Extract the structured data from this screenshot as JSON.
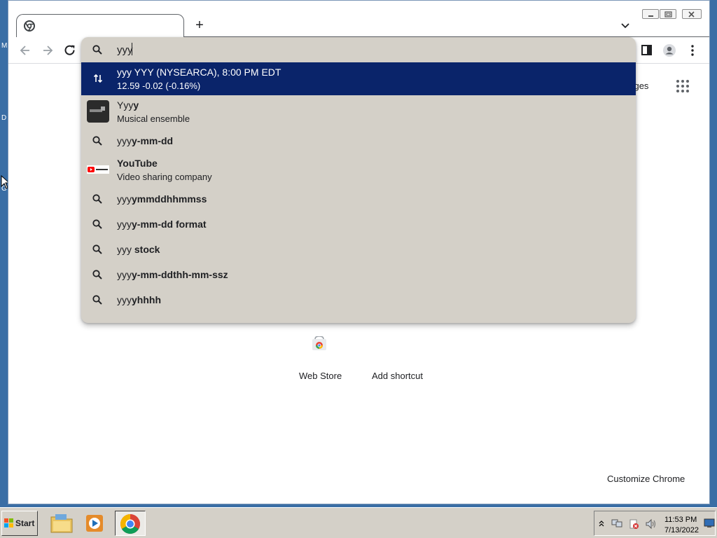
{
  "desktop": {
    "fragments": [
      "M",
      "D",
      "G"
    ]
  },
  "browser": {
    "tab": {
      "icon": "chrome-icon",
      "title": ""
    },
    "new_tab_label": "+",
    "omnibox": {
      "value": "yyy",
      "suggestions": [
        {
          "icon": "stock-arrows-icon",
          "line1_plain": "yyy YYY (NYSEARCA), 8:00 PM EDT",
          "line1_bold": "",
          "line2": "12.59 -0.02 (-0.16%)",
          "selected": true
        },
        {
          "icon": "album-thumbnail",
          "line1_plain": "Yyy",
          "line1_bold": "y",
          "line2": "Musical ensemble"
        },
        {
          "icon": "search-icon",
          "line1_plain": "yyy",
          "line1_bold": "y-mm-dd"
        },
        {
          "icon": "youtube-icon",
          "line1_plain": "",
          "line1_bold": "YouTube",
          "line2": "Video sharing company"
        },
        {
          "icon": "search-icon",
          "line1_plain": "yyy",
          "line1_bold": "ymmddhhmmss"
        },
        {
          "icon": "search-icon",
          "line1_plain": "yyy",
          "line1_bold": "y-mm-dd format"
        },
        {
          "icon": "search-icon",
          "line1_plain": "yyy ",
          "line1_bold": "stock"
        },
        {
          "icon": "search-icon",
          "line1_plain": "yyy",
          "line1_bold": "y-mm-ddthh-mm-ssz"
        },
        {
          "icon": "search-icon",
          "line1_plain": "yyy",
          "line1_bold": "yhhhh"
        }
      ]
    },
    "page": {
      "images_link": "nages",
      "shortcuts": [
        {
          "label": "Web Store",
          "icon": "webstore-icon"
        },
        {
          "label": "Add shortcut",
          "icon": ""
        }
      ],
      "customize_label": "Customize Chrome"
    }
  },
  "taskbar": {
    "start_label": "Start",
    "clock_time": "11:53 PM",
    "clock_date": "7/13/2022"
  },
  "colors": {
    "desktop": "#3a6ea5",
    "selected_row": "#0a246a",
    "dropdown_bg": "#d4d0c8"
  }
}
